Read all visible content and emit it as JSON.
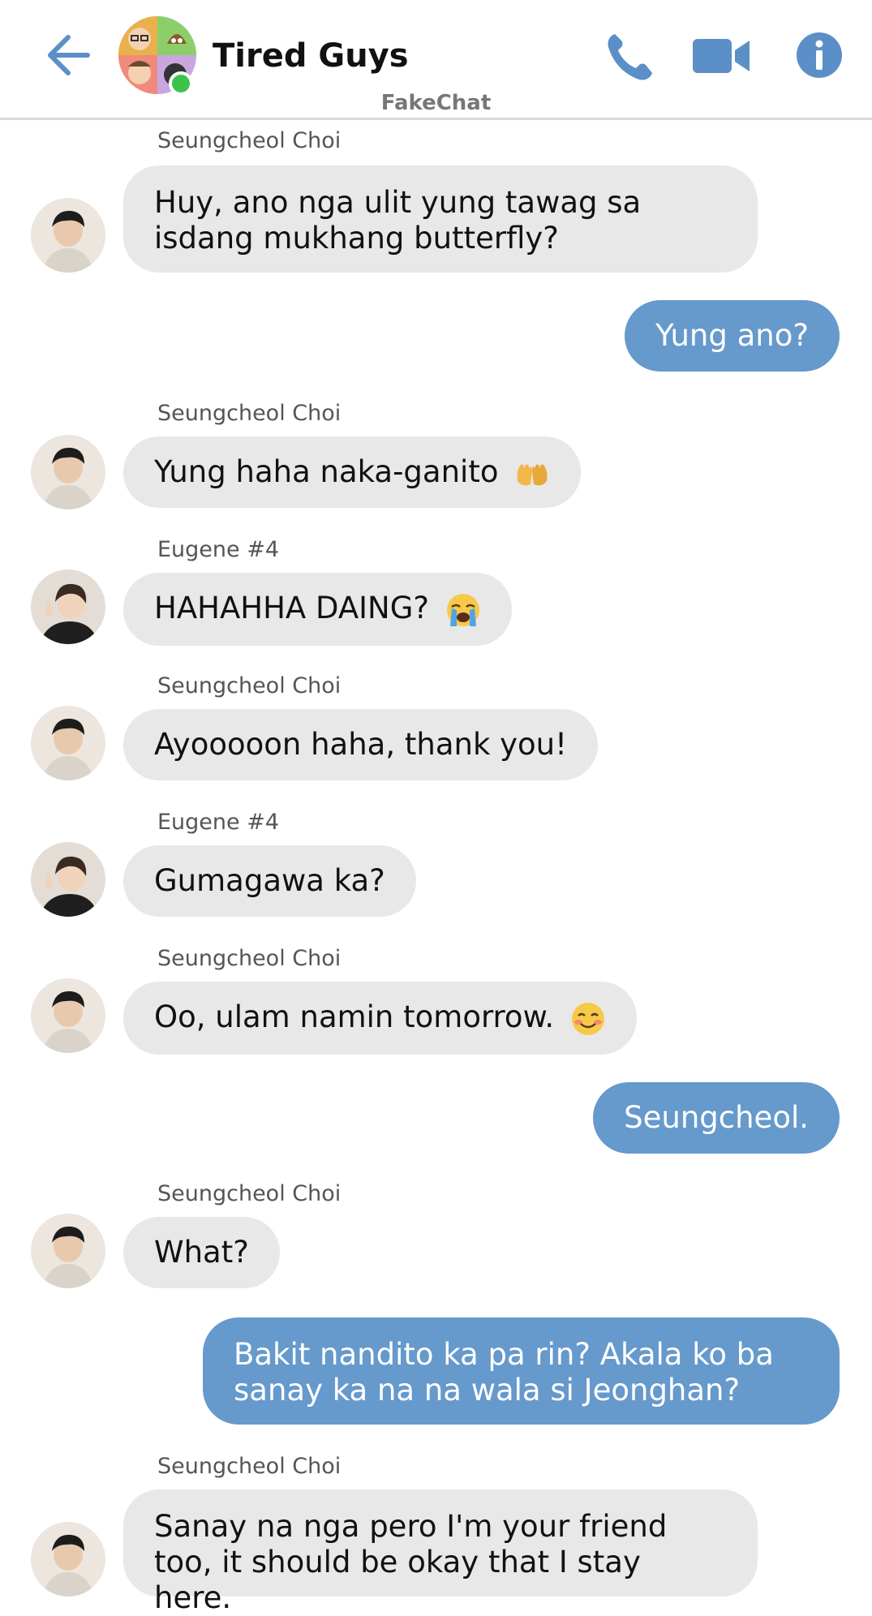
{
  "header": {
    "title": "Tired Guys",
    "watermark": "FakeChat"
  },
  "messages": [
    {
      "sender": "Seungcheol Choi",
      "text": "Huy, ano nga ulit yung tawag sa isdang mukhang butterfly?"
    },
    {
      "outgoing": true,
      "text": "Yung ano?"
    },
    {
      "sender": "Seungcheol Choi",
      "text": "Yung haha naka-ganito",
      "emoji": "open-hands"
    },
    {
      "sender": "Eugene #4",
      "text": "HAHAHHA DAING?",
      "emoji": "loudly-crying-face"
    },
    {
      "sender": "Seungcheol Choi",
      "text": "Ayooooon haha, thank you!"
    },
    {
      "sender": "Eugene #4",
      "text": "Gumagawa ka?"
    },
    {
      "sender": "Seungcheol Choi",
      "text": "Oo, ulam namin tomorrow.",
      "emoji": "smiling-blushing-face"
    },
    {
      "outgoing": true,
      "text": "Seungcheol."
    },
    {
      "sender": "Seungcheol Choi",
      "text": "What?"
    },
    {
      "outgoing": true,
      "text": "Bakit nandito ka pa rin? Akala ko ba sanay ka na na wala si Jeonghan?"
    },
    {
      "sender": "Seungcheol Choi",
      "text": "Sanay na nga pero I'm your friend too, it should be okay that I stay here."
    }
  ],
  "colors": {
    "accent": "#6699cc",
    "incoming_bubble": "#e8e8e8",
    "online": "#3cc34b"
  }
}
